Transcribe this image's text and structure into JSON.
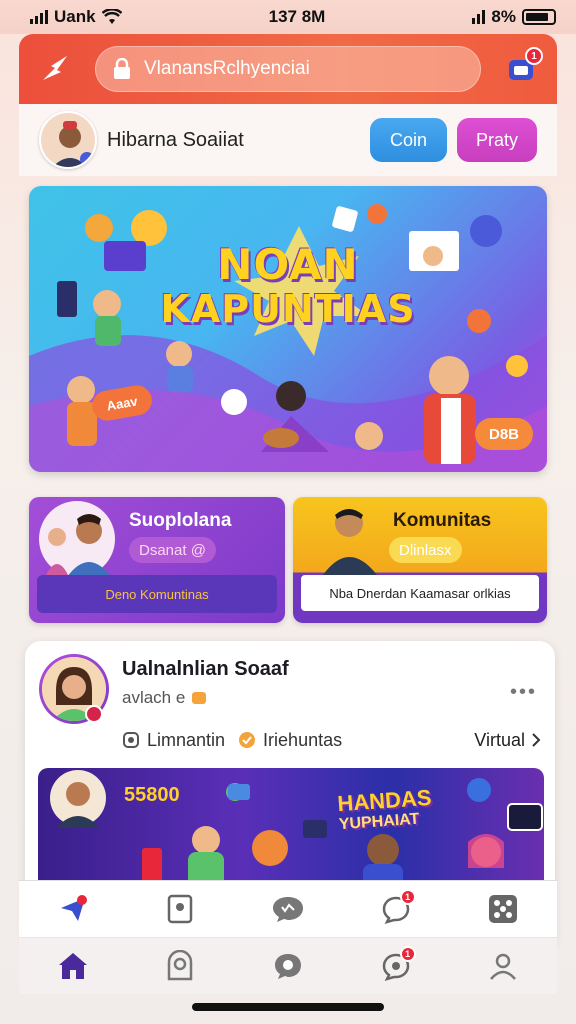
{
  "status_bar": {
    "carrier": "Uank",
    "time": "137 8M",
    "battery": "8%"
  },
  "header": {
    "logo_icon": "lightning-icon",
    "search_placeholder": "VlanansRclhyenciai",
    "notification_count": "1",
    "accent": "#ec4f3b"
  },
  "profile": {
    "name": "Hibarna Soaiiat",
    "btn_blue": "Coin",
    "btn_pink": "Praty"
  },
  "banner": {
    "line1": "NOAN",
    "line2": "KAPUNTIAS",
    "tag": "Aaav",
    "badge": "D8B"
  },
  "cards": {
    "left": {
      "title": "Suoplolana",
      "pill": "Dsanat @",
      "bottom": "Deno Komuntinas"
    },
    "right": {
      "title": "Komunitas",
      "pill": "Dlinlasx",
      "bottom": "Nba Dnerdan Kaamasar orlkias"
    }
  },
  "post": {
    "title": "Ualnalnlian Soaaf",
    "meta": "avlach e",
    "action1": "Limnantin",
    "action2": "Iriehuntas",
    "right_link": "Virtual",
    "banner_number": "55800",
    "banner_title_1": "HANDAS",
    "banner_title_2": "YUPHAIAT"
  },
  "tabs_top": [
    {
      "icon": "send-icon",
      "badge": ""
    },
    {
      "icon": "bookmark-icon",
      "badge": ""
    },
    {
      "icon": "chat-icon",
      "badge": ""
    },
    {
      "icon": "comment-icon",
      "badge": "1"
    },
    {
      "icon": "dice-icon",
      "badge": ""
    }
  ],
  "tabs_bottom": [
    {
      "icon": "home-icon",
      "badge": ""
    },
    {
      "icon": "group-icon",
      "badge": ""
    },
    {
      "icon": "message-icon",
      "badge": ""
    },
    {
      "icon": "notification-icon",
      "badge": "1"
    },
    {
      "icon": "profile-icon",
      "badge": ""
    }
  ]
}
